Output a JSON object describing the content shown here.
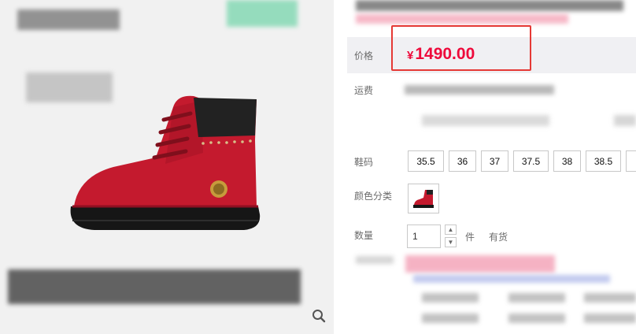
{
  "price": {
    "label": "价格",
    "currency": "¥",
    "amount": "1490.00",
    "color": "#ee0a3b",
    "highlight_border": "#e53935"
  },
  "shipping": {
    "label": "运费"
  },
  "size": {
    "label": "鞋码",
    "options": [
      "35.5",
      "36",
      "37",
      "37.5",
      "38",
      "38.5"
    ]
  },
  "color_variant": {
    "label": "颜色分类",
    "thumbnail": "red-boot-thumbnail"
  },
  "quantity": {
    "label": "数量",
    "value": "1",
    "unit": "件",
    "stock": "有货"
  },
  "gallery": {
    "image": "red-suede-boot",
    "zoom_icon": "magnifier-icon"
  }
}
